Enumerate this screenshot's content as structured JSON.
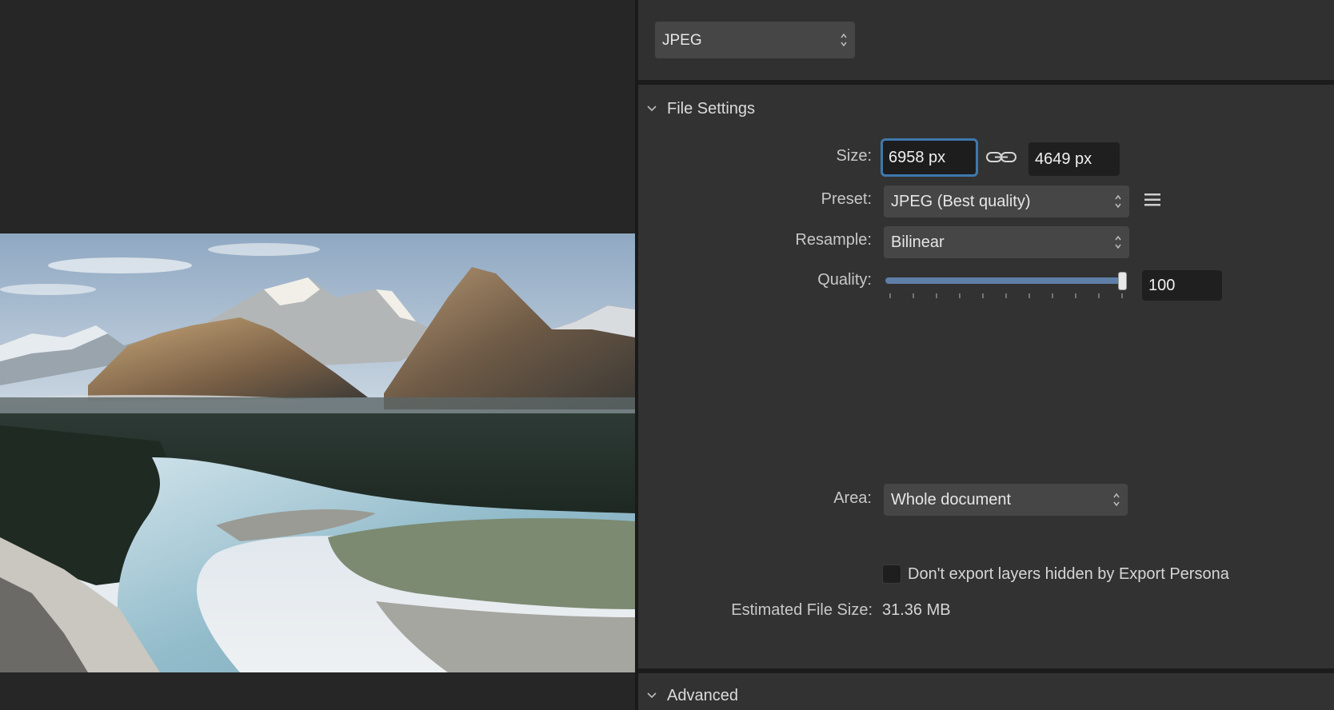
{
  "format": {
    "selected": "JPEG"
  },
  "file_settings": {
    "header": "File Settings",
    "size_label": "Size:",
    "width_value": "6958 px",
    "height_value": "4649 px",
    "preset_label": "Preset:",
    "preset_value": "JPEG (Best quality)",
    "resample_label": "Resample:",
    "resample_value": "Bilinear",
    "quality_label": "Quality:",
    "quality_value": "100",
    "quality_level": 1.0,
    "area_label": "Area:",
    "area_value": "Whole document",
    "hidden_layers_checkbox_label": "Don't export layers hidden by Export Persona",
    "hidden_layers_checked": false,
    "estimated_size_label": "Estimated File Size:",
    "estimated_size_value": "31.36 MB"
  },
  "advanced": {
    "header": "Advanced"
  },
  "colors": {
    "accent": "#3f78ad",
    "slider_fill": "#5f7fa8",
    "panel_bg": "#323232",
    "field_bg": "#1f1f1f"
  },
  "icons": {
    "link": "chain-link-icon",
    "menu": "hamburger-menu-icon",
    "collapse": "chevron-down-icon",
    "stepper": "up-down-arrows-icon"
  }
}
